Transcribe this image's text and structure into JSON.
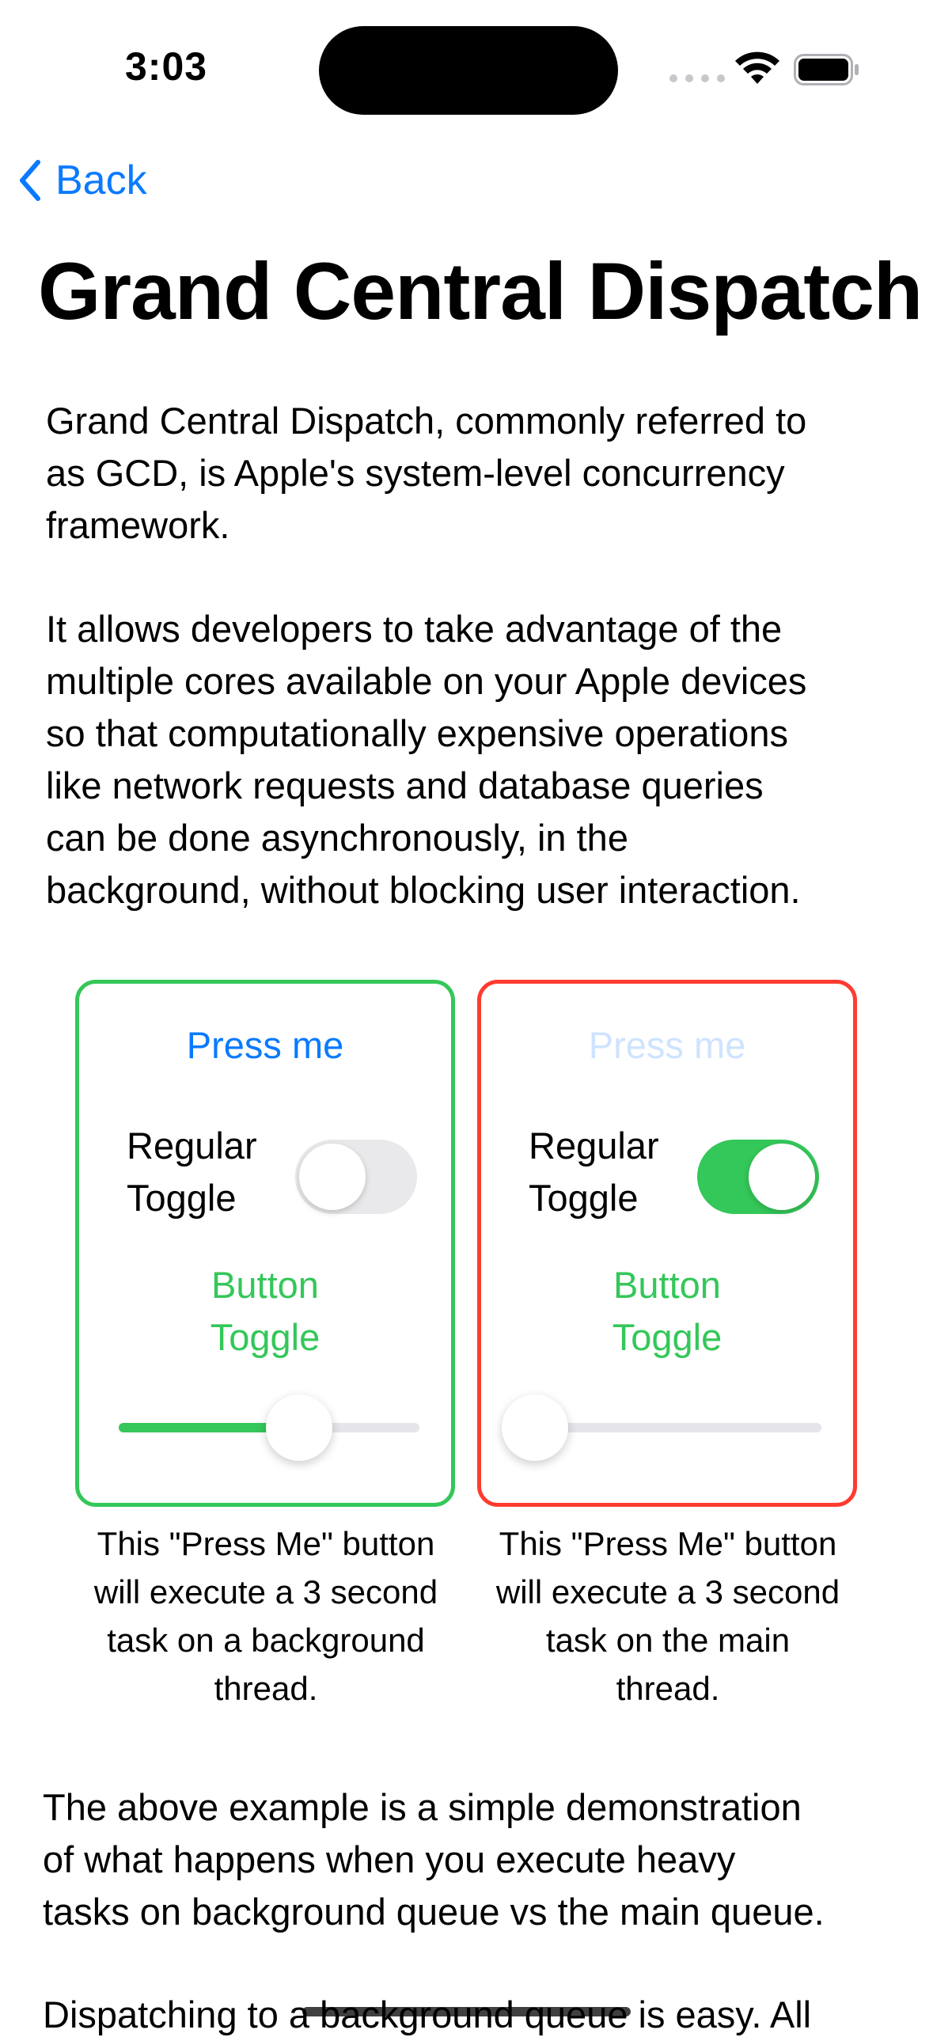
{
  "status_bar": {
    "time": "3:03"
  },
  "nav": {
    "back_label": "Back"
  },
  "page": {
    "title": "Grand Central Dispatch",
    "intro_lines": [
      "Grand Central Dispatch, commonly referred to",
      "as GCD, is Apple's system-level concurrency",
      "framework."
    ],
    "body_lines": [
      "It allows developers to take advantage of the",
      "multiple cores available on your Apple devices",
      "so that computationally expensive operations",
      "like network requests and database queries",
      "can be done asynchronously, in the",
      "background, without blocking user interaction."
    ],
    "summary_lines": [
      "The above example is a simple demonstration",
      "of what happens when you execute heavy",
      "tasks on background queue vs the main queue."
    ],
    "next_lines": [
      "Dispatching to a background queue is easy. All"
    ]
  },
  "demos": {
    "background": {
      "press_label": "Press me",
      "toggle_label": [
        "Regular",
        "Toggle"
      ],
      "toggle_on": false,
      "button_toggle_label": [
        "Button",
        "Toggle"
      ],
      "slider_value": 0.6,
      "border_color": "#34c759",
      "caption_lines": [
        "This \"Press Me\" button",
        "will execute a 3 second",
        "task on a background",
        "thread."
      ]
    },
    "main": {
      "press_label": "Press me",
      "press_disabled": true,
      "toggle_label": [
        "Regular",
        "Toggle"
      ],
      "toggle_on": true,
      "button_toggle_label": [
        "Button",
        "Toggle"
      ],
      "slider_value": 0.0,
      "border_color": "#ff3b30",
      "caption_lines": [
        "This \"Press Me\" button",
        "will execute a 3 second",
        "task on the main",
        "thread."
      ]
    }
  },
  "colors": {
    "accent": "#0a7aff",
    "green": "#34c759",
    "red": "#ff3b30"
  }
}
